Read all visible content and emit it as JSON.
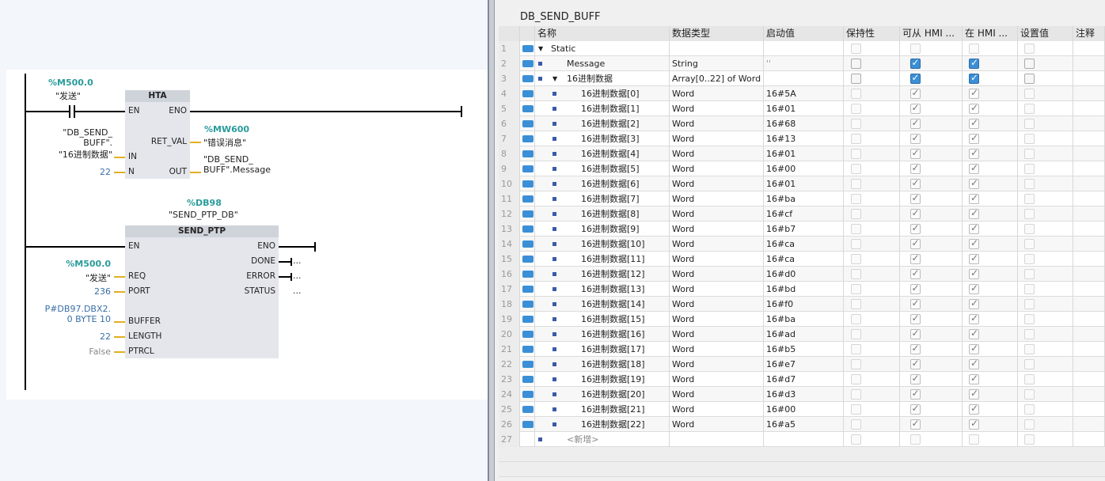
{
  "ladder": {
    "hta": {
      "contact_addr": "%M500.0",
      "contact_name": "\"发送\"",
      "title": "HTA",
      "en": "EN",
      "eno": "ENO",
      "ret_val": "RET_VAL",
      "in": "IN",
      "n": "N",
      "out": "OUT",
      "in_line1": "\"DB_SEND_",
      "in_line2": "BUFF\".",
      "in_line3": "\"16进制数据\"",
      "n_val": "22",
      "ret_addr": "%MW600",
      "ret_name": "\"错误消息\"",
      "out_line1": "\"DB_SEND_",
      "out_line2": "BUFF\".Message"
    },
    "ptp": {
      "db_addr": "%DB98",
      "db_name": "\"SEND_PTP_DB\"",
      "title": "SEND_PTP",
      "en": "EN",
      "eno": "ENO",
      "req": "REQ",
      "port": "PORT",
      "buffer": "BUFFER",
      "length": "LENGTH",
      "ptrcl": "PTRCL",
      "done": "DONE",
      "error": "ERROR",
      "status": "STATUS",
      "req_addr": "%M500.0",
      "req_name": "\"发送\"",
      "port_val": "236",
      "buf_line1": "P#DB97.DBX2.",
      "buf_line2": "0 BYTE 10",
      "length_val": "22",
      "ptrcl_val": "False",
      "dots": "..."
    }
  },
  "db": {
    "title": "DB_SEND_BUFF",
    "headers": [
      "名称",
      "数据类型",
      "启动值",
      "保持性",
      "可从 HMI ...",
      "在 HMI ...",
      "设置值",
      "注释"
    ],
    "rows": [
      {
        "n": "1",
        "name": "Static",
        "type": "",
        "start": "",
        "kind": "section"
      },
      {
        "n": "2",
        "name": "Message",
        "type": "String",
        "start": "''",
        "kind": "top"
      },
      {
        "n": "3",
        "name": "16进制数据",
        "type": "Array[0..22] of Word",
        "start": "",
        "kind": "top"
      },
      {
        "n": "4",
        "name": "16进制数据[0]",
        "type": "Word",
        "start": "16#5A",
        "kind": "elem"
      },
      {
        "n": "5",
        "name": "16进制数据[1]",
        "type": "Word",
        "start": "16#01",
        "kind": "elem"
      },
      {
        "n": "6",
        "name": "16进制数据[2]",
        "type": "Word",
        "start": "16#68",
        "kind": "elem"
      },
      {
        "n": "7",
        "name": "16进制数据[3]",
        "type": "Word",
        "start": "16#13",
        "kind": "elem"
      },
      {
        "n": "8",
        "name": "16进制数据[4]",
        "type": "Word",
        "start": "16#01",
        "kind": "elem"
      },
      {
        "n": "9",
        "name": "16进制数据[5]",
        "type": "Word",
        "start": "16#00",
        "kind": "elem"
      },
      {
        "n": "10",
        "name": "16进制数据[6]",
        "type": "Word",
        "start": "16#01",
        "kind": "elem"
      },
      {
        "n": "11",
        "name": "16进制数据[7]",
        "type": "Word",
        "start": "16#ba",
        "kind": "elem"
      },
      {
        "n": "12",
        "name": "16进制数据[8]",
        "type": "Word",
        "start": "16#cf",
        "kind": "elem"
      },
      {
        "n": "13",
        "name": "16进制数据[9]",
        "type": "Word",
        "start": "16#b7",
        "kind": "elem"
      },
      {
        "n": "14",
        "name": "16进制数据[10]",
        "type": "Word",
        "start": "16#ca",
        "kind": "elem"
      },
      {
        "n": "15",
        "name": "16进制数据[11]",
        "type": "Word",
        "start": "16#ca",
        "kind": "elem"
      },
      {
        "n": "16",
        "name": "16进制数据[12]",
        "type": "Word",
        "start": "16#d0",
        "kind": "elem"
      },
      {
        "n": "17",
        "name": "16进制数据[13]",
        "type": "Word",
        "start": "16#bd",
        "kind": "elem"
      },
      {
        "n": "18",
        "name": "16进制数据[14]",
        "type": "Word",
        "start": "16#f0",
        "kind": "elem"
      },
      {
        "n": "19",
        "name": "16进制数据[15]",
        "type": "Word",
        "start": "16#ba",
        "kind": "elem"
      },
      {
        "n": "20",
        "name": "16进制数据[16]",
        "type": "Word",
        "start": "16#ad",
        "kind": "elem"
      },
      {
        "n": "21",
        "name": "16进制数据[17]",
        "type": "Word",
        "start": "16#b5",
        "kind": "elem"
      },
      {
        "n": "22",
        "name": "16进制数据[18]",
        "type": "Word",
        "start": "16#e7",
        "kind": "elem"
      },
      {
        "n": "23",
        "name": "16进制数据[19]",
        "type": "Word",
        "start": "16#d7",
        "kind": "elem"
      },
      {
        "n": "24",
        "name": "16进制数据[20]",
        "type": "Word",
        "start": "16#d3",
        "kind": "elem"
      },
      {
        "n": "25",
        "name": "16进制数据[21]",
        "type": "Word",
        "start": "16#00",
        "kind": "elem"
      },
      {
        "n": "26",
        "name": "16进制数据[22]",
        "type": "Word",
        "start": "16#a5",
        "kind": "elem"
      },
      {
        "n": "27",
        "name": "<新增>",
        "type": "",
        "start": "",
        "kind": "add"
      }
    ]
  }
}
